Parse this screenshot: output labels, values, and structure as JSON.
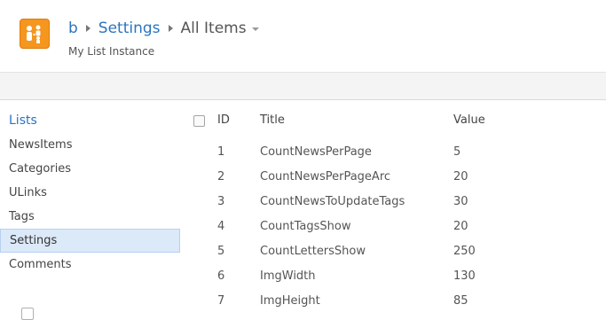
{
  "header": {
    "breadcrumb": [
      "b",
      "Settings"
    ],
    "current_view": "All Items",
    "subtitle": "My List Instance"
  },
  "left_nav": {
    "heading": "Lists",
    "items": [
      {
        "label": "NewsItems",
        "selected": false
      },
      {
        "label": "Categories",
        "selected": false
      },
      {
        "label": "ULinks",
        "selected": false
      },
      {
        "label": "Tags",
        "selected": false
      },
      {
        "label": "Settings",
        "selected": true
      },
      {
        "label": "Comments",
        "selected": false
      }
    ]
  },
  "list": {
    "columns": {
      "id": "ID",
      "title": "Title",
      "value": "Value"
    },
    "rows": [
      {
        "id": "1",
        "title": "CountNewsPerPage",
        "value": "5"
      },
      {
        "id": "2",
        "title": "CountNewsPerPageArc",
        "value": "20"
      },
      {
        "id": "3",
        "title": "CountNewsToUpdateTags",
        "value": "30"
      },
      {
        "id": "4",
        "title": "CountTagsShow",
        "value": "20"
      },
      {
        "id": "5",
        "title": "CountLettersShow",
        "value": "250"
      },
      {
        "id": "6",
        "title": "ImgWidth",
        "value": "130"
      },
      {
        "id": "7",
        "title": "ImgHeight",
        "value": "85"
      }
    ]
  },
  "colors": {
    "link_blue": "#2a74c1",
    "logo_orange": "#f5961e",
    "selected_nav_bg": "#dce9f9"
  },
  "icons": {
    "site_logo": "site-people-icon"
  }
}
